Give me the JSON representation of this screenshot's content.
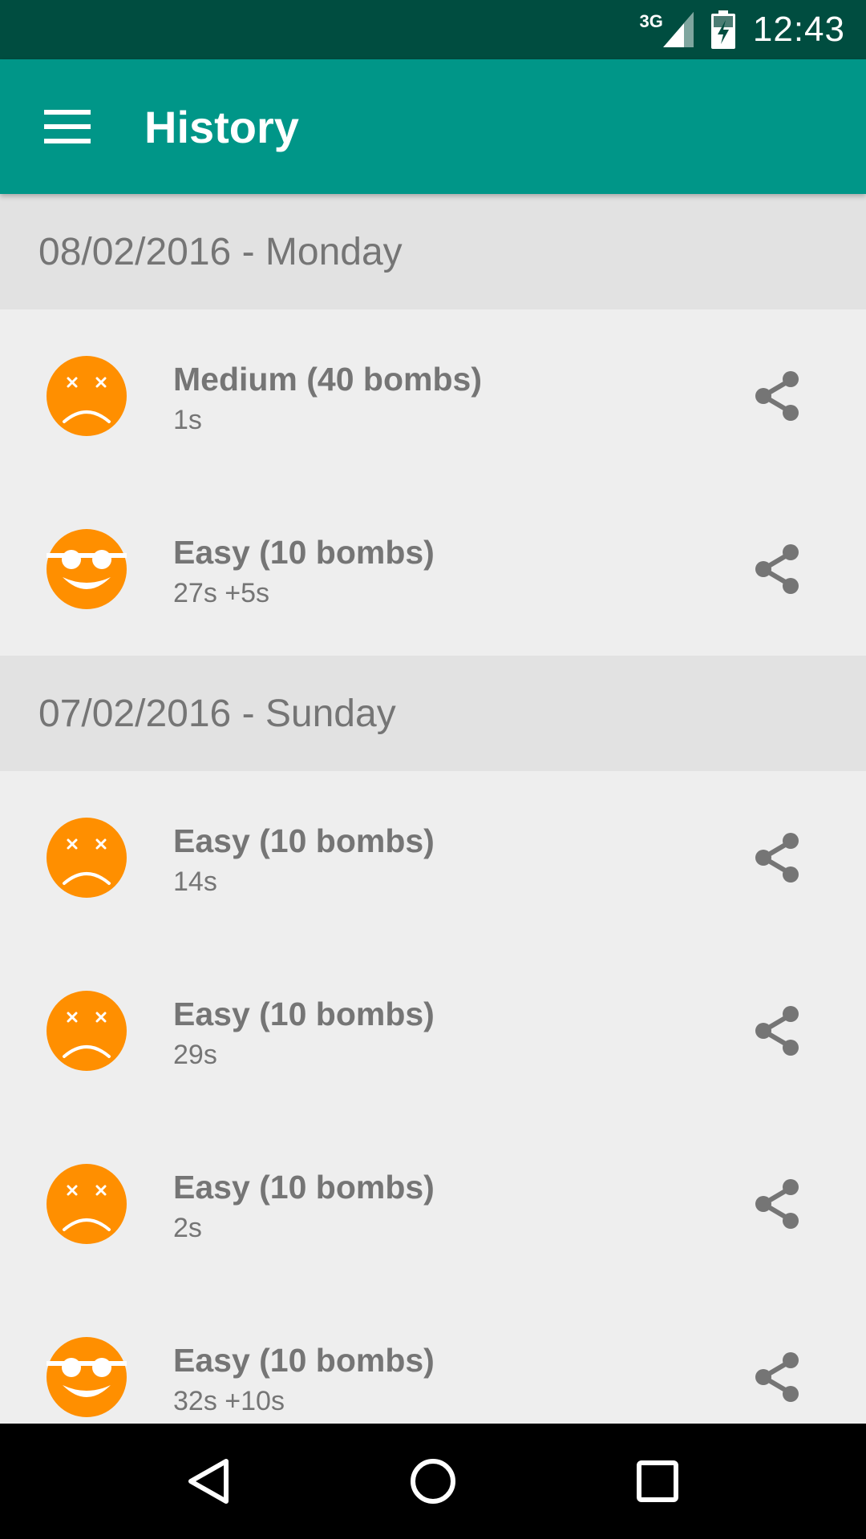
{
  "status_bar": {
    "network": "3G",
    "time": "12:43"
  },
  "app_bar": {
    "title": "History",
    "menu_icon": "hamburger-menu-icon"
  },
  "sections": [
    {
      "header": "08/02/2016 - Monday",
      "items": [
        {
          "title": "Medium (40 bombs)",
          "time": "1s",
          "result": "lost",
          "icon": "sad-face-icon"
        },
        {
          "title": "Easy (10 bombs)",
          "time": "27s +5s",
          "result": "won",
          "icon": "cool-face-icon"
        }
      ]
    },
    {
      "header": "07/02/2016 - Sunday",
      "items": [
        {
          "title": "Easy (10 bombs)",
          "time": "14s",
          "result": "lost",
          "icon": "sad-face-icon"
        },
        {
          "title": "Easy (10 bombs)",
          "time": "29s",
          "result": "lost",
          "icon": "sad-face-icon"
        },
        {
          "title": "Easy (10 bombs)",
          "time": "2s",
          "result": "lost",
          "icon": "sad-face-icon"
        },
        {
          "title": "Easy (10 bombs)",
          "time": "32s +10s",
          "result": "won",
          "icon": "cool-face-icon"
        }
      ]
    }
  ],
  "colors": {
    "status_bar": "#004d40",
    "app_bar": "#009688",
    "face": "#ff8f00",
    "text": "#757575"
  }
}
